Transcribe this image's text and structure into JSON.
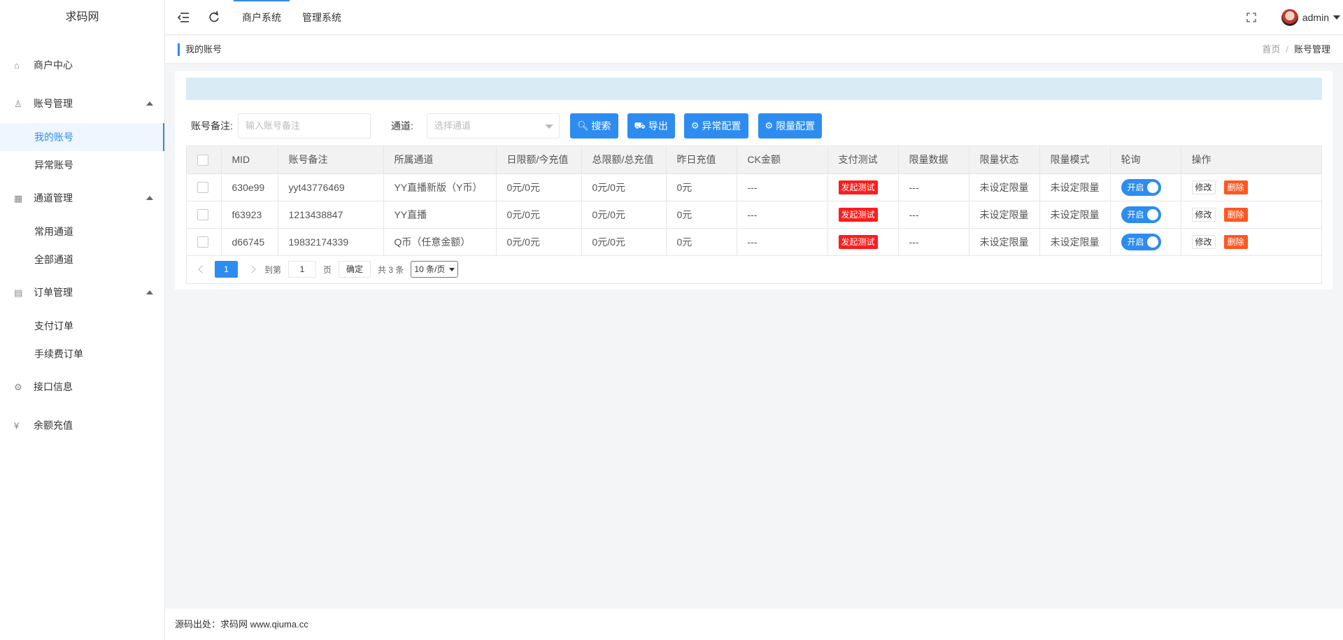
{
  "sidebar": {
    "logo": "求码网",
    "items": [
      {
        "label": "商户中心",
        "icon": "home-icon"
      },
      {
        "label": "账号管理",
        "icon": "user-icon",
        "children": [
          "我的账号",
          "异常账号"
        ]
      },
      {
        "label": "通道管理",
        "icon": "grid-icon",
        "children": [
          "常用通道",
          "全部通道"
        ]
      },
      {
        "label": "订单管理",
        "icon": "chart-icon",
        "children": [
          "支付订单",
          "手续费订单"
        ]
      },
      {
        "label": "接口信息",
        "icon": "gear-icon"
      },
      {
        "label": "余额充值",
        "icon": "yen-icon"
      }
    ]
  },
  "header": {
    "tabs": [
      "商户系统",
      "管理系统"
    ],
    "user": "admin"
  },
  "tabbar": {
    "current_page": "我的账号",
    "breadcrumb": [
      "首页",
      "账号管理"
    ],
    "breadcrumb_sep": "/"
  },
  "filters": {
    "remark_label": "账号备注:",
    "remark_placeholder": "输入账号备注",
    "channel_label": "通道:",
    "channel_placeholder": "选择通道",
    "buttons": [
      "搜索",
      "导出",
      "异常配置",
      "限量配置"
    ]
  },
  "table": {
    "columns": [
      "MID",
      "账号备注",
      "所属通道",
      "日限额/今充值",
      "总限额/总充值",
      "昨日充值",
      "CK金额",
      "支付测试",
      "限量数据",
      "限量状态",
      "限量模式",
      "轮询",
      "操作"
    ],
    "rows": [
      [
        "630e99",
        "yyt43776469",
        "YY直播新版（Y币）",
        "0元/0元",
        "0元/0元",
        "0元",
        "---",
        "发起测试",
        "---",
        "未设定限量",
        "未设定限量",
        "开启",
        "修改|删除"
      ],
      [
        "f63923",
        "1213438847",
        "YY直播",
        "0元/0元",
        "0元/0元",
        "0元",
        "---",
        "发起测试",
        "---",
        "未设定限量",
        "未设定限量",
        "开启",
        "修改|删除"
      ],
      [
        "d66745",
        "19832174339",
        "Q币（任意金额）",
        "0元/0元",
        "0元/0元",
        "0元",
        "---",
        "发起测试",
        "---",
        "未设定限量",
        "未设定限量",
        "开启",
        "修改|删除"
      ]
    ],
    "edit_label": "修改",
    "delete_label": "删除"
  },
  "pager": {
    "current": "1",
    "goto_label": "到第",
    "goto_value": "1",
    "page_unit": "页",
    "ok_label": "确定",
    "total": "共 3 条",
    "page_size": "10 条/页"
  },
  "footer": {
    "text": "源码出处：求码网 www.qiuma.cc"
  },
  "colors": {
    "primary": "#2d8cf0",
    "danger": "#ff1c1c",
    "delete": "#ff5722",
    "notice_bg": "#d9ecf6"
  }
}
